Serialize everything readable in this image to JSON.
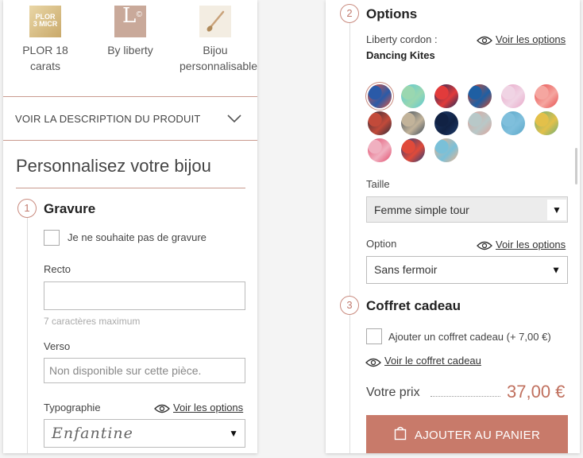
{
  "features": [
    {
      "label_line1": "PLOR 18",
      "label_line2": "carats",
      "icon": "plor-gold-icon",
      "icon_text_1": "PLOR",
      "icon_text_2": "3 MICR"
    },
    {
      "label_line1": "By liberty",
      "label_line2": "",
      "icon": "liberty-logo-icon",
      "icon_letter": "L",
      "icon_mark": "©"
    },
    {
      "label_line1": "Bijou",
      "label_line2": "personnalisable",
      "icon": "paintbrush-icon"
    }
  ],
  "description_toggle": "VOIR LA DESCRIPTION DU PRODUIT",
  "personalize": {
    "title": "Personnalisez votre bijou",
    "engraving": {
      "step": "1",
      "title": "Gravure",
      "no_engraving_label": "Je ne souhaite pas de gravure",
      "recto_label": "Recto",
      "recto_value": "",
      "recto_hint": "7 caractères maximum",
      "verso_label": "Verso",
      "verso_placeholder": "Non disponible sur cette pièce.",
      "typography_label": "Typographie",
      "typography_link": "Voir les options",
      "typography_value": "Enfantine"
    },
    "options": {
      "step": "2",
      "title": "Options",
      "liberty_label": "Liberty cordon :",
      "liberty_link": "Voir les options",
      "liberty_value": "Dancing Kites",
      "size_label": "Taille",
      "size_value": "Femme simple tour",
      "option_label": "Option",
      "option_link": "Voir les options",
      "option_value": "Sans fermoir"
    },
    "gift": {
      "step": "3",
      "title": "Coffret cadeau",
      "add_label": "Ajouter un coffret cadeau (+ 7,00 €)",
      "view_link": "Voir le coffret cadeau"
    }
  },
  "price": {
    "label": "Votre prix",
    "value": "37,00 €"
  },
  "add_to_cart": "AJOUTER AU PANIER",
  "swatch_colors": [
    [
      "#e8553d",
      "#2a5aa8"
    ],
    [
      "#5cc9d6",
      "#9ad7b0"
    ],
    [
      "#1a2a5a",
      "#e23b3b"
    ],
    [
      "#d8492b",
      "#1e5fa3"
    ],
    [
      "#e9a6c8",
      "#f0d4e4"
    ],
    [
      "#e64b4b",
      "#f5a6a0"
    ],
    [
      "#2b2b3a",
      "#c24a3a"
    ],
    [
      "#3a4a5a",
      "#c2b39a"
    ],
    [
      "#1d3b6a",
      "#112244"
    ],
    [
      "#e0a39a",
      "#b8c8c8"
    ],
    [
      "#5aa7c8",
      "#7fbfdc"
    ],
    [
      "#6ab07a",
      "#e3c04a"
    ],
    [
      "#e24a6a",
      "#f0b0c0"
    ],
    [
      "#22407a",
      "#e04a3a"
    ],
    [
      "#f0b28a",
      "#7ac0d8"
    ]
  ]
}
